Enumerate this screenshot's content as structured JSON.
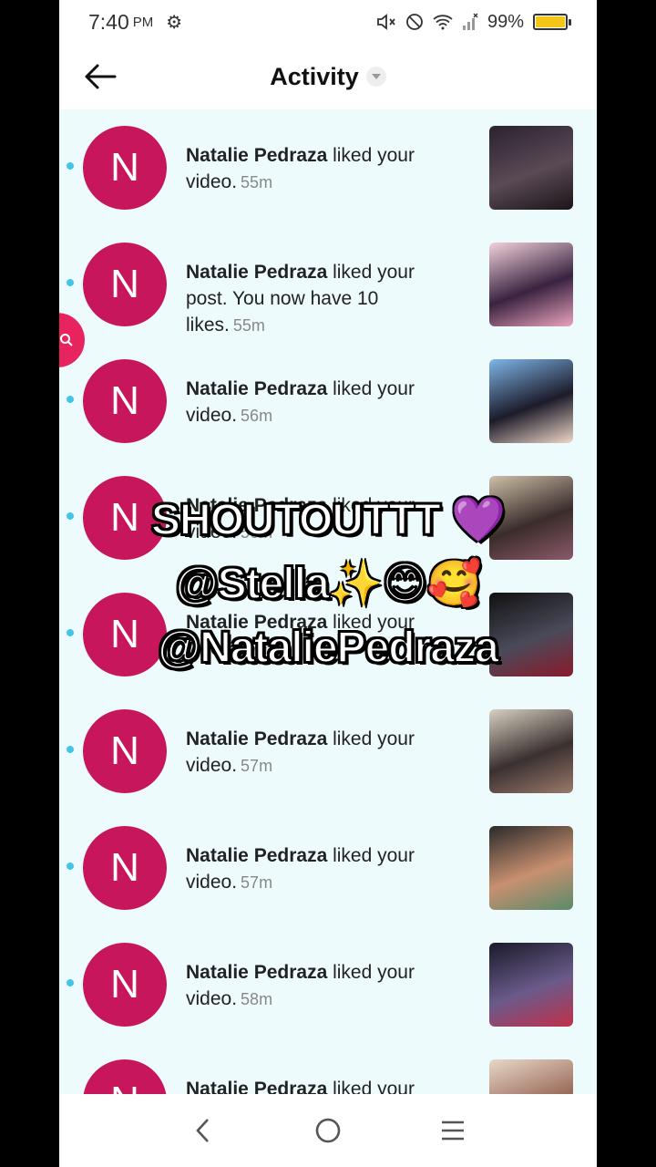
{
  "status": {
    "time": "7:40",
    "ampm": "PM",
    "battery": "99%",
    "battery_level": 0.99
  },
  "header": {
    "title": "Activity"
  },
  "notifications": [
    {
      "name": "Natalie Pedraza",
      "action": "liked your video.",
      "time": "55m",
      "avatar": "N",
      "thumb": [
        "#2b2230",
        "#5a4a55",
        "#1a1418"
      ]
    },
    {
      "name": "Natalie Pedraza",
      "action": "liked your post. You now have 10 likes.",
      "time": "55m",
      "avatar": "N",
      "thumb": [
        "#f2d2dc",
        "#3a2340",
        "#e9a3be"
      ]
    },
    {
      "name": "Natalie Pedraza",
      "action": "liked your video.",
      "time": "56m",
      "avatar": "N",
      "thumb": [
        "#7fb6e8",
        "#1c1b2a",
        "#f0d8c8"
      ]
    },
    {
      "name": "Natalie Pedraza",
      "action": "liked your video.",
      "time": "56m",
      "avatar": "N",
      "thumb": [
        "#cdbfa8",
        "#3a2c2a",
        "#8c5a6a"
      ]
    },
    {
      "name": "Natalie Pedraza",
      "action": "liked your video.",
      "time": "57m",
      "avatar": "N",
      "thumb": [
        "#111111",
        "#4a4a5a",
        "#8a1a2a"
      ]
    },
    {
      "name": "Natalie Pedraza",
      "action": "liked your video.",
      "time": "57m",
      "avatar": "N",
      "thumb": [
        "#d8d0c0",
        "#3a3030",
        "#9a7a6a"
      ]
    },
    {
      "name": "Natalie Pedraza",
      "action": "liked your video.",
      "time": "57m",
      "avatar": "N",
      "thumb": [
        "#2a2a2a",
        "#c89070",
        "#5a8a6a"
      ]
    },
    {
      "name": "Natalie Pedraza",
      "action": "liked your video.",
      "time": "58m",
      "avatar": "N",
      "thumb": [
        "#1a1a2a",
        "#6a5a8a",
        "#c0304a"
      ]
    },
    {
      "name": "Natalie Pedraza",
      "action": "liked your",
      "time": "",
      "avatar": "N",
      "thumb": [
        "#e8d8c8",
        "#9a6a5a",
        "#f0c0a0"
      ]
    }
  ],
  "overlay": {
    "line1": "SHOUTOUTTT 💜",
    "line2": "@Stella✨😊🥰",
    "line3": "@NataliePedraza"
  },
  "colors": {
    "avatar": "#c8165c",
    "list_bg": "#eefbfd",
    "unread_dot": "#3ec8e6",
    "fab": "#e8245f"
  }
}
